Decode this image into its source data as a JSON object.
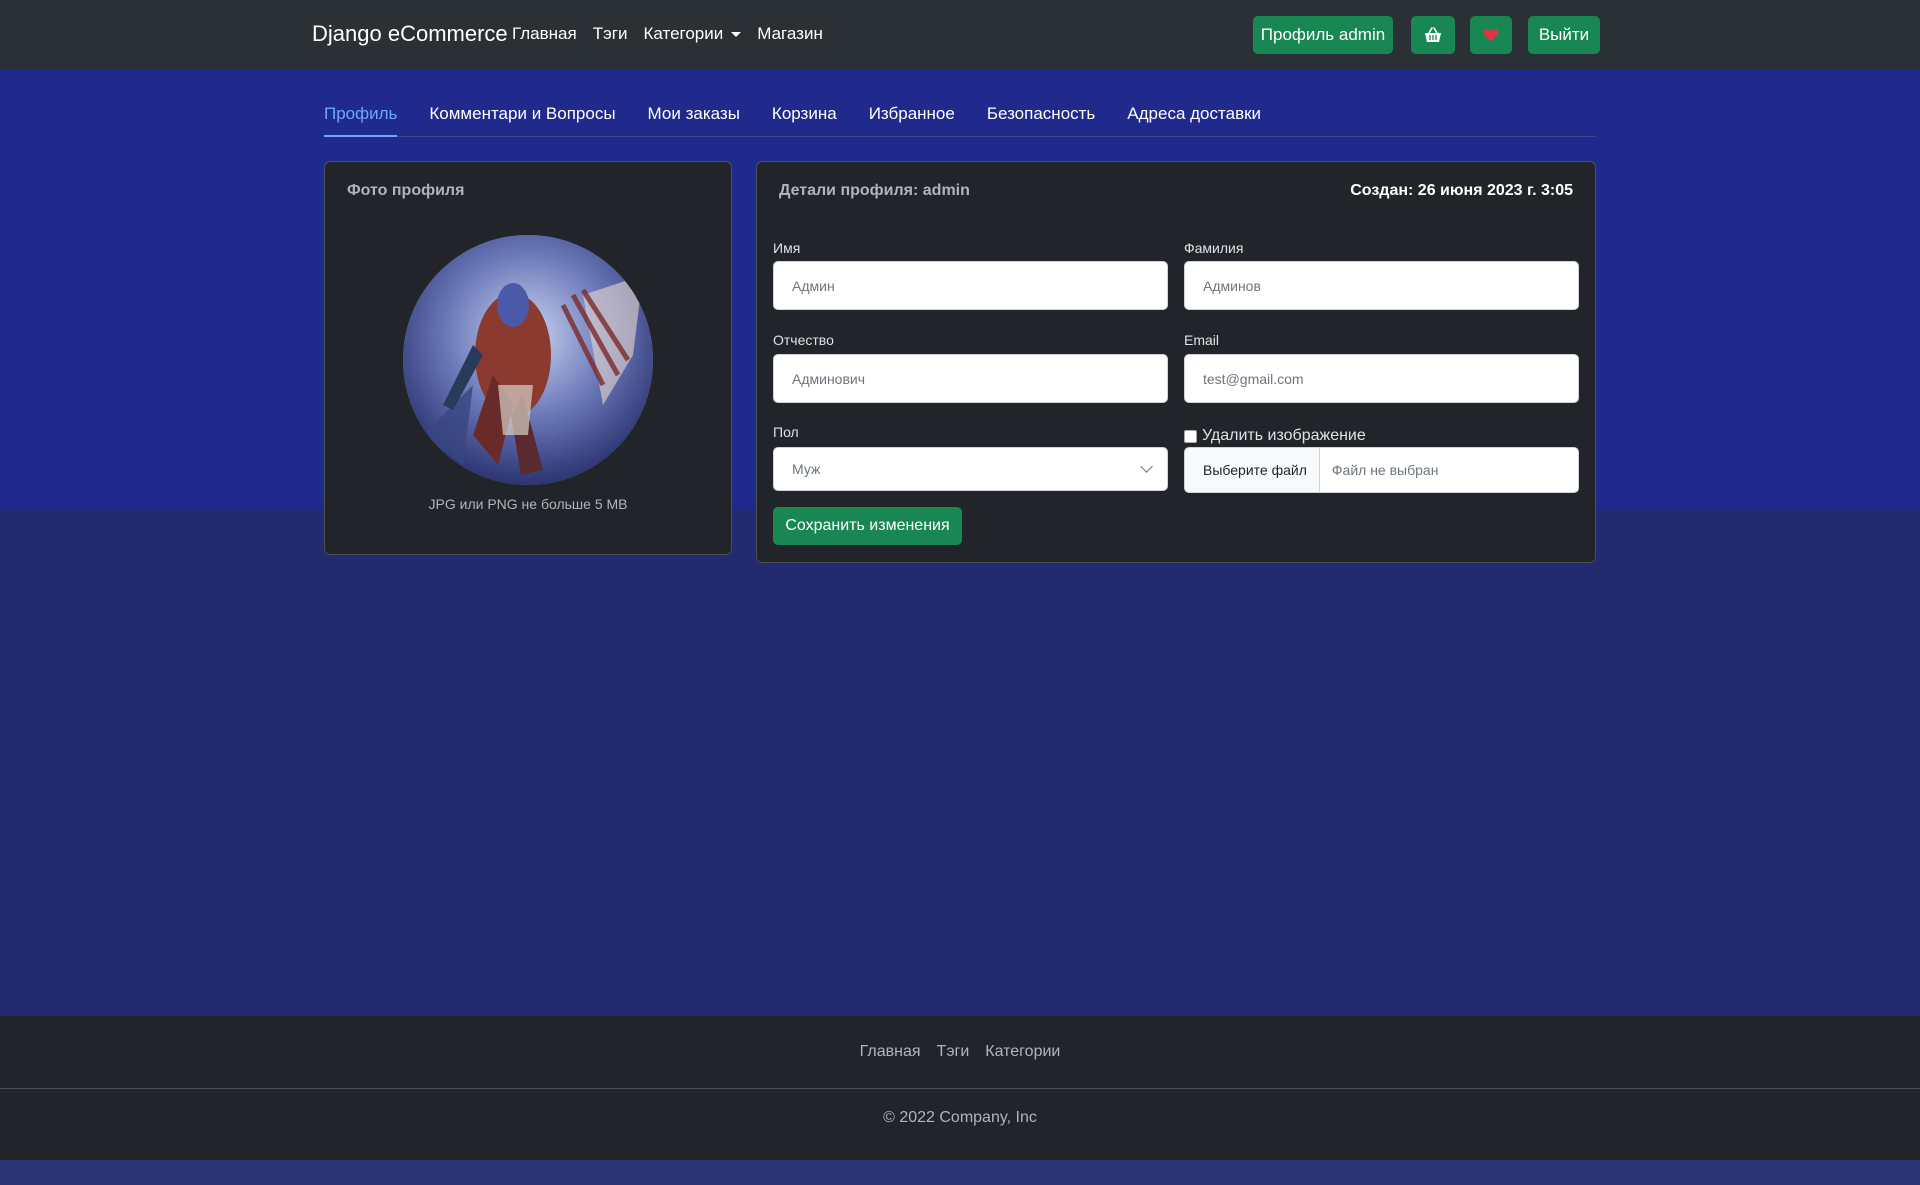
{
  "navbar": {
    "brand": "Django eCommerce",
    "links": [
      "Главная",
      "Тэги",
      "Категории",
      "Магазин"
    ],
    "profile_button": "Профиль admin",
    "cart_icon": "basket-icon",
    "favorites_icon": "heart-icon",
    "logout_button": "Выйти"
  },
  "tabs": [
    {
      "label": "Профиль",
      "active": true
    },
    {
      "label": "Комментари и Вопросы",
      "active": false
    },
    {
      "label": "Мои заказы",
      "active": false
    },
    {
      "label": "Корзина",
      "active": false
    },
    {
      "label": "Избранное",
      "active": false
    },
    {
      "label": "Безопасность",
      "active": false
    },
    {
      "label": "Адреса доставки",
      "active": false
    }
  ],
  "photo_card": {
    "title": "Фото профиля",
    "caption": "JPG или PNG не больше 5 MB"
  },
  "details_card": {
    "title": "Детали профиля: admin",
    "created": "Создан: 26 июня 2023 г. 3:05",
    "fields": {
      "first_name": {
        "label": "Имя",
        "value": "Админ"
      },
      "last_name": {
        "label": "Фамилия",
        "value": "Админов"
      },
      "patronymic": {
        "label": "Отчество",
        "value": "Админович"
      },
      "email": {
        "label": "Email",
        "value": "test@gmail.com"
      },
      "gender": {
        "label": "Пол",
        "value": "Муж"
      }
    },
    "delete_image_label": "Удалить изображение",
    "file_button": "Выберите файл",
    "file_status": "Файл не выбран",
    "save_button": "Сохранить изменения"
  },
  "footer": {
    "links": [
      "Главная",
      "Тэги",
      "Категории"
    ],
    "copyright": "© 2022 Company, Inc"
  },
  "colors": {
    "accent_green": "#198754",
    "navbar_bg": "#2b3035",
    "page_bg": "#1f2a8c",
    "card_bg": "#212529",
    "active_tab": "#6ea8fe",
    "heart": "#dc3545"
  }
}
